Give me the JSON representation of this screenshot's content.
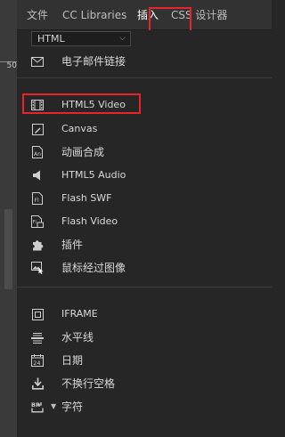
{
  "left_strip": {
    "ruler_number": "50"
  },
  "tabs": [
    {
      "label": "文件",
      "active": false
    },
    {
      "label": "CC Libraries",
      "active": false
    },
    {
      "label": "插入",
      "active": true
    },
    {
      "label": "CSS 设计器",
      "active": false
    }
  ],
  "category_select": {
    "value": "HTML"
  },
  "items": [
    {
      "label": "电子邮件链接",
      "icon": "envelope-icon"
    },
    {
      "label": "HTML5 Video",
      "icon": "film-strip-icon"
    },
    {
      "label": "Canvas",
      "icon": "canvas-icon"
    },
    {
      "label": "动画合成",
      "icon": "animation-file-icon"
    },
    {
      "label": "HTML5 Audio",
      "icon": "speaker-icon"
    },
    {
      "label": "Flash SWF",
      "icon": "flash-file-icon"
    },
    {
      "label": "Flash Video",
      "icon": "flash-video-icon"
    },
    {
      "label": "插件",
      "icon": "puzzle-piece-icon"
    },
    {
      "label": "鼠标经过图像",
      "icon": "rollover-image-icon"
    },
    {
      "label": "IFRAME",
      "icon": "iframe-icon"
    },
    {
      "label": "水平线",
      "icon": "horizontal-rule-icon"
    },
    {
      "label": "日期",
      "icon": "calendar-icon"
    },
    {
      "label": "不换行空格",
      "icon": "nbsp-icon"
    },
    {
      "label": "字符",
      "icon": "special-character-icon"
    }
  ],
  "calendar_number": "24",
  "character_icon_text": "BR",
  "highlight_color": "#e8232a"
}
